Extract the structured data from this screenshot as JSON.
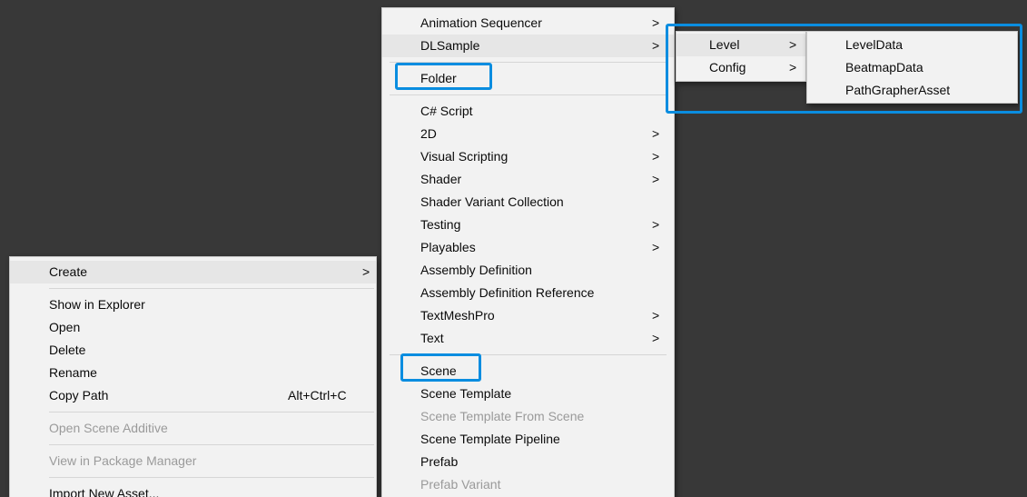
{
  "context_menu": {
    "create": "Create",
    "show_in_explorer": "Show in Explorer",
    "open": "Open",
    "delete": "Delete",
    "rename": "Rename",
    "copy_path": "Copy Path",
    "copy_path_shortcut": "Alt+Ctrl+C",
    "open_scene_additive": "Open Scene Additive",
    "view_in_package_manager": "View in Package Manager",
    "import_new_asset": "Import New Asset..."
  },
  "create_menu": {
    "animation_sequencer": "Animation Sequencer",
    "dlsample": "DLSample",
    "folder": "Folder",
    "csharp_script": "C# Script",
    "two_d": "2D",
    "visual_scripting": "Visual Scripting",
    "shader": "Shader",
    "shader_variant_collection": "Shader Variant Collection",
    "testing": "Testing",
    "playables": "Playables",
    "assembly_definition": "Assembly Definition",
    "assembly_definition_reference": "Assembly Definition Reference",
    "textmeshpro": "TextMeshPro",
    "text": "Text",
    "scene": "Scene",
    "scene_template": "Scene Template",
    "scene_template_from_scene": "Scene Template From Scene",
    "scene_template_pipeline": "Scene Template Pipeline",
    "prefab": "Prefab",
    "prefab_variant": "Prefab Variant"
  },
  "dlsample_menu": {
    "level": "Level",
    "config": "Config"
  },
  "level_menu": {
    "level_data": "LevelData",
    "beatmap_data": "BeatmapData",
    "path_grapher_asset": "PathGrapherAsset"
  },
  "glyphs": {
    "submenu_arrow": ">"
  },
  "colors": {
    "background": "#383838",
    "menu_bg": "#f2f2f2",
    "hover_bg": "#e6e6e6",
    "highlight_box": "#0a8de0",
    "disabled_text": "#9a9a9a"
  }
}
